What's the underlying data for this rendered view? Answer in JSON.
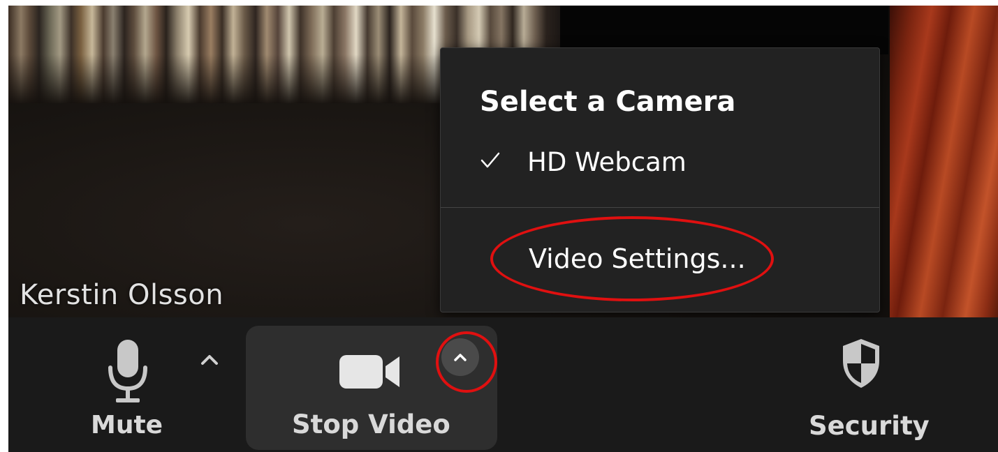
{
  "video": {
    "participant_name": "Kerstin Olsson"
  },
  "camera_menu": {
    "heading": "Select a Camera",
    "cameras": [
      {
        "label": "HD Webcam",
        "selected": true
      }
    ],
    "settings_label": "Video Settings..."
  },
  "toolbar": {
    "mute_label": "Mute",
    "stop_video_label": "Stop Video",
    "security_label": "Security"
  },
  "colors": {
    "highlight": "#e01010",
    "toolbar_bg": "#1a1a1a",
    "menu_bg": "#222222"
  },
  "icons": {
    "mute": "microphone-icon",
    "video": "video-camera-icon",
    "security": "shield-icon",
    "selected_camera": "check-icon",
    "chevron": "chevron-up-icon"
  }
}
